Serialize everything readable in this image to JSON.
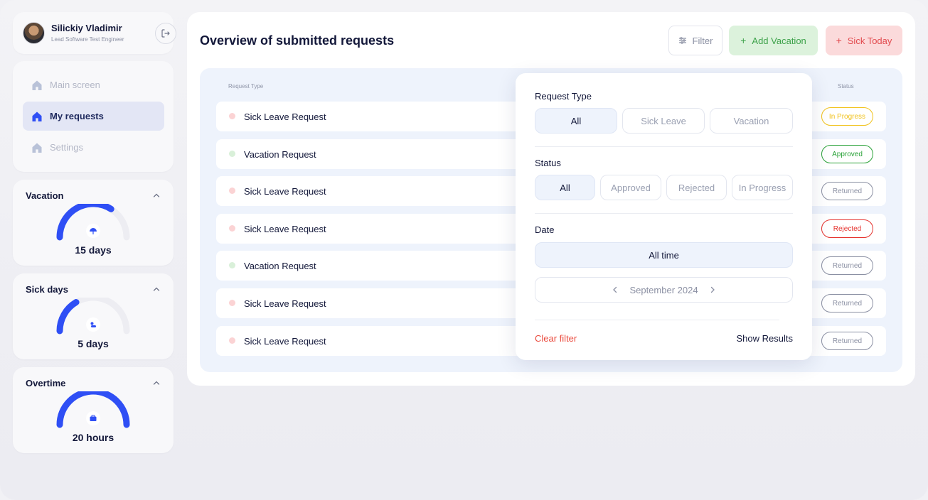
{
  "user": {
    "name": "Silickiy Vladimir",
    "role": "Lead Software Test Engineer"
  },
  "nav": {
    "items": [
      {
        "label": "Main screen",
        "active": false
      },
      {
        "label": "My requests",
        "active": true
      },
      {
        "label": "Settings",
        "active": false
      }
    ]
  },
  "stats": [
    {
      "title": "Vacation",
      "value": "15 days",
      "fraction": 0.68,
      "icon": "umbrella-icon"
    },
    {
      "title": "Sick days",
      "value": "5 days",
      "fraction": 0.33,
      "icon": "pill-icon"
    },
    {
      "title": "Overtime",
      "value": "20 hours",
      "fraction": 1.0,
      "icon": "briefcase-icon"
    }
  ],
  "main": {
    "title": "Overview of submitted requests",
    "filter_label": "Filter",
    "add_vacation_label": "Add Vacation",
    "sick_today_label": "Sick Today"
  },
  "table": {
    "headers": {
      "type": "Request Type",
      "status": "Status"
    },
    "rows": [
      {
        "type": "Sick Leave Request",
        "kind": "sick",
        "status": "In Progress"
      },
      {
        "type": "Vacation Request",
        "kind": "vacation",
        "status": "Approved"
      },
      {
        "type": "Sick Leave Request",
        "kind": "sick",
        "status": "Returned"
      },
      {
        "type": "Sick Leave Request",
        "kind": "sick",
        "status": "Rejected"
      },
      {
        "type": "Vacation Request",
        "kind": "vacation",
        "status": "Returned"
      },
      {
        "type": "Sick Leave Request",
        "kind": "sick",
        "status": "Returned"
      },
      {
        "type": "Sick Leave Request",
        "kind": "sick",
        "status": "Returned"
      }
    ]
  },
  "filter": {
    "request_type_label": "Request Type",
    "request_type_options": [
      "All",
      "Sick Leave",
      "Vacation"
    ],
    "status_label": "Status",
    "status_options": [
      "All",
      "Approved",
      "Rejected",
      "In Progress"
    ],
    "date_label": "Date",
    "date_all": "All time",
    "month": "September 2024",
    "clear_label": "Clear filter",
    "show_label": "Show Results"
  },
  "colors": {
    "accent": "#2f4ff5",
    "sick_dot": "#fbd3d4",
    "vacation_dot": "#d9f0d9",
    "in_progress": "#f1c21b",
    "approved": "#2aa238",
    "rejected": "#e5312c",
    "returned": "#8b90a3"
  }
}
